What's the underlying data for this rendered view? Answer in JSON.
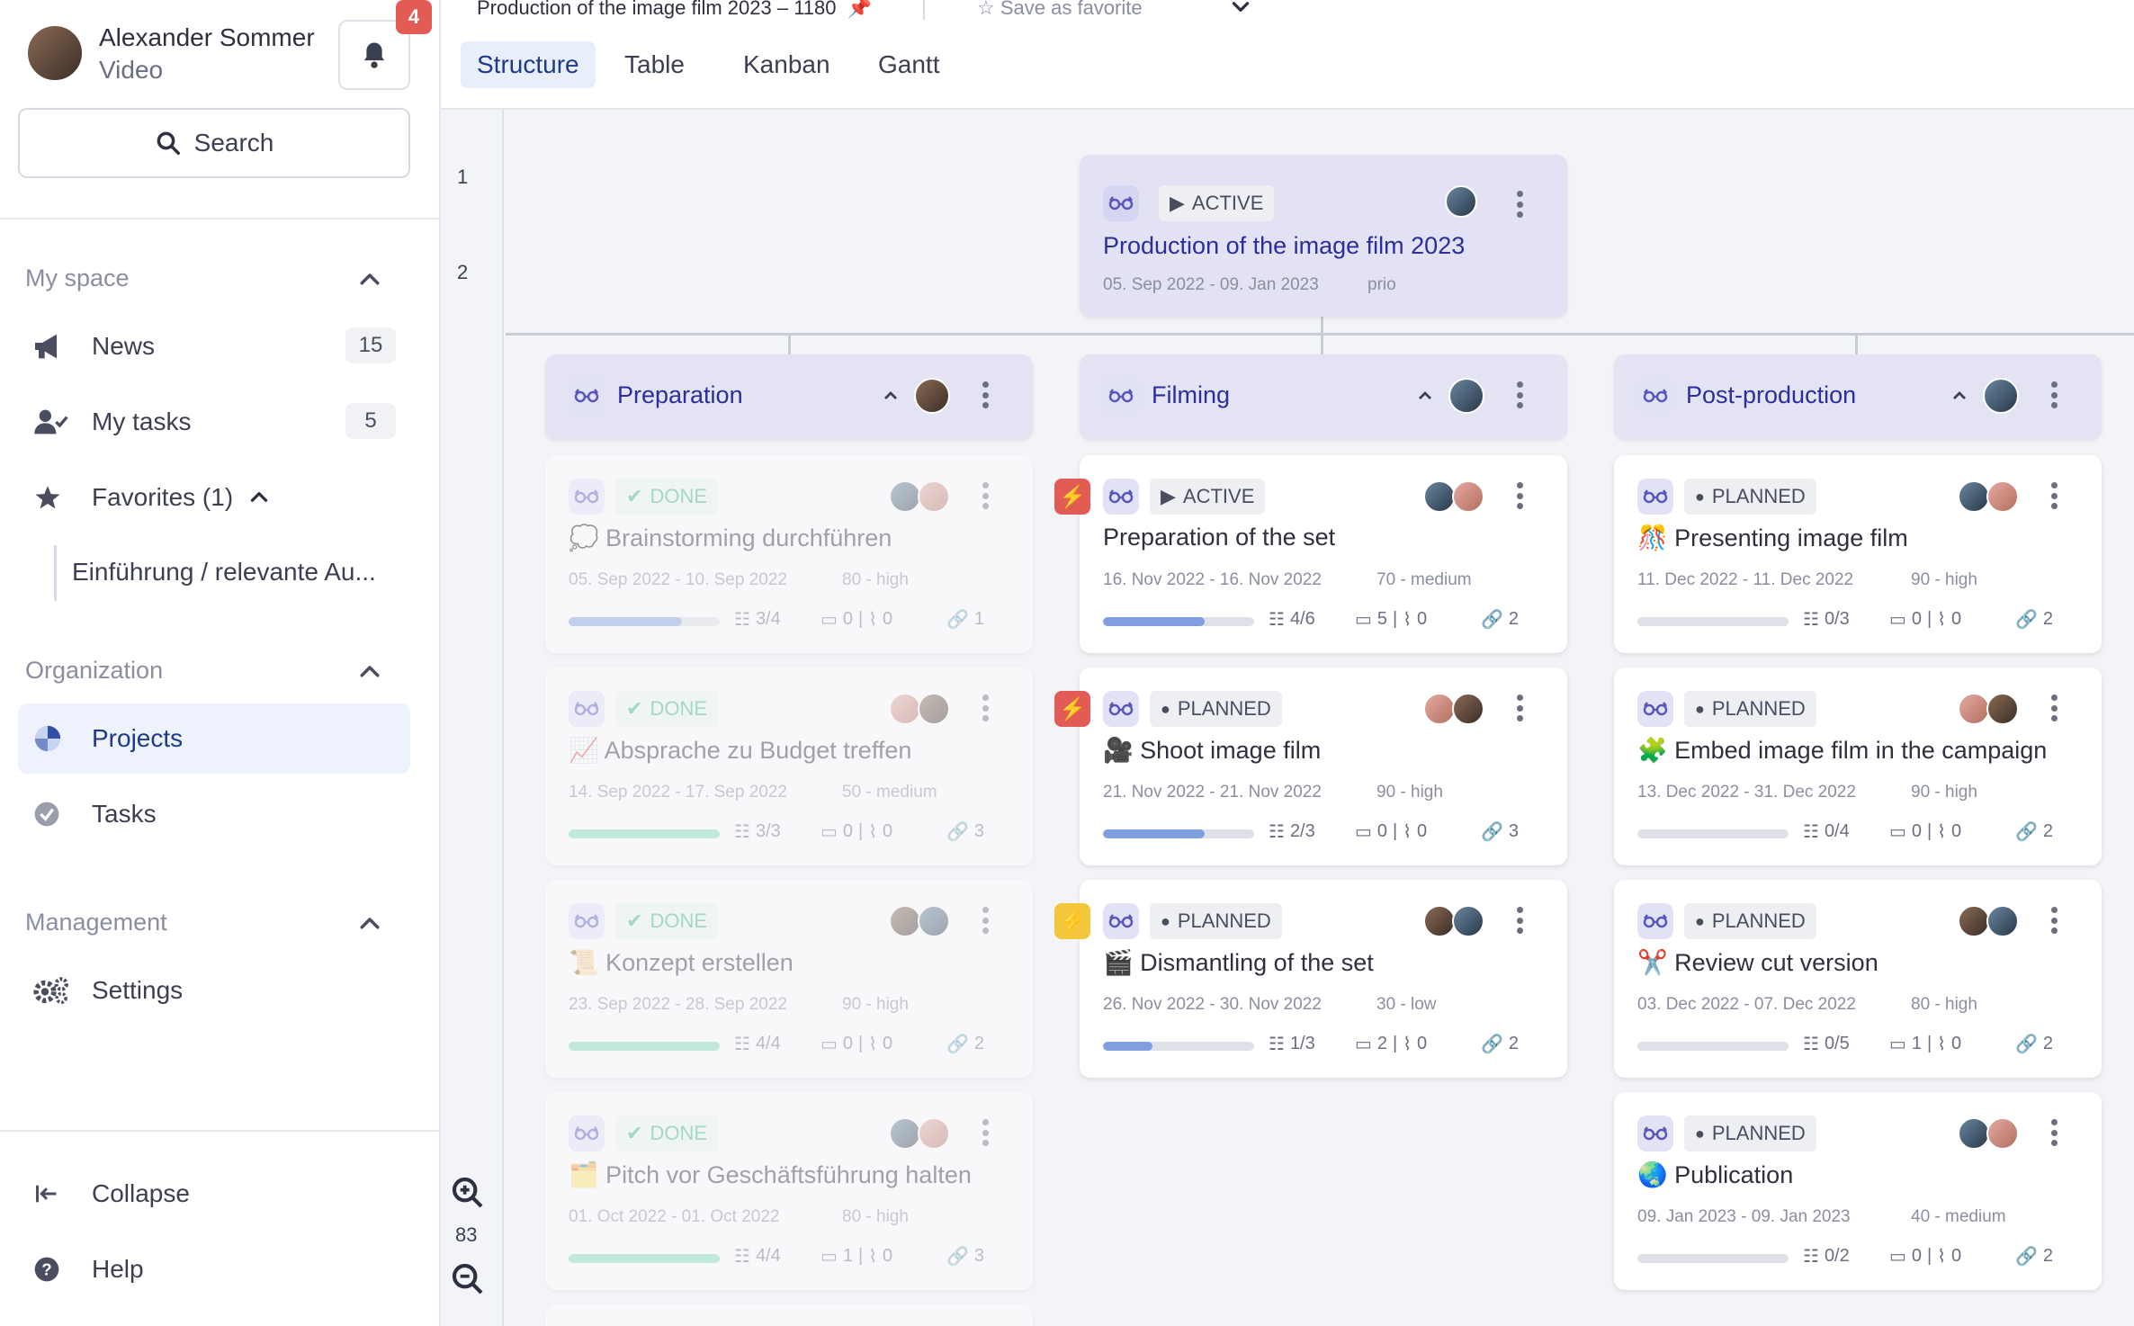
{
  "user": {
    "name": "Alexander Sommer",
    "role": "Video",
    "notifications": "4"
  },
  "search": {
    "label": "Search"
  },
  "sections": {
    "my_space": "My space",
    "organization": "Organization",
    "management": "Management"
  },
  "nav": {
    "news": {
      "label": "News",
      "count": "15"
    },
    "my_tasks": {
      "label": "My tasks",
      "count": "5"
    },
    "favorites": {
      "label": "Favorites (1)"
    },
    "favorite_item": {
      "label": "Einführung / relevante Au..."
    },
    "projects": {
      "label": "Projects"
    },
    "tasks": {
      "label": "Tasks"
    },
    "settings": {
      "label": "Settings"
    },
    "collapse": {
      "label": "Collapse"
    },
    "help": {
      "label": "Help"
    }
  },
  "header": {
    "breadcrumb": "Production of the image film 2023 – 1180",
    "save_favorite": "Save as favorite",
    "tabs": [
      "Structure",
      "Table",
      "Kanban",
      "Gantt"
    ],
    "active_tab": "Structure"
  },
  "rows": [
    "1",
    "2"
  ],
  "zoom": "83",
  "root": {
    "status": "ACTIVE",
    "title": "Production of the image film 2023",
    "dates": "05. Sep 2022 - 09. Jan 2023",
    "prio": "prio"
  },
  "columns": [
    {
      "title": "Preparation"
    },
    {
      "title": "Filming"
    },
    {
      "title": "Post-production"
    }
  ],
  "cards": {
    "prep": [
      {
        "status": "DONE",
        "title": "Brainstorming durchführen",
        "emoji": "💭",
        "dates": "05. Sep 2022 - 10. Sep 2022",
        "prio": "80 - high",
        "tasks": "3/4",
        "comments": "0",
        "attachments": "0",
        "links": "1",
        "progress": 0.75
      },
      {
        "status": "DONE",
        "title": "Absprache zu Budget treffen",
        "emoji": "📈",
        "dates": "14. Sep 2022 - 17. Sep 2022",
        "prio": "50 - medium",
        "tasks": "3/3",
        "comments": "0",
        "attachments": "0",
        "links": "3",
        "progress": 1.0
      },
      {
        "status": "DONE",
        "title": "Konzept erstellen",
        "emoji": "📜",
        "dates": "23. Sep 2022 - 28. Sep 2022",
        "prio": "90 - high",
        "tasks": "4/4",
        "comments": "0",
        "attachments": "0",
        "links": "2",
        "progress": 1.0
      },
      {
        "status": "DONE",
        "title": "Pitch vor Geschäftsführung halten",
        "emoji": "🗂️",
        "dates": "01. Oct 2022 - 01. Oct 2022",
        "prio": "80 - high",
        "tasks": "4/4",
        "comments": "1",
        "attachments": "0",
        "links": "3",
        "progress": 1.0
      }
    ],
    "film": [
      {
        "status": "ACTIVE",
        "title": "Preparation of the set",
        "emoji": "",
        "dates": "16. Nov 2022 - 16. Nov 2022",
        "prio": "70 - medium",
        "tasks": "4/6",
        "comments": "5",
        "attachments": "0",
        "links": "2",
        "progress": 0.67
      },
      {
        "status": "PLANNED",
        "title": "Shoot image film",
        "emoji": "🎥",
        "dates": "21. Nov 2022 - 21. Nov 2022",
        "prio": "90 - high",
        "tasks": "2/3",
        "comments": "0",
        "attachments": "0",
        "links": "3",
        "progress": 0.67
      },
      {
        "status": "PLANNED",
        "title": "Dismantling of the set",
        "emoji": "🎬",
        "dates": "26. Nov 2022 - 30. Nov 2022",
        "prio": "30 - low",
        "tasks": "1/3",
        "comments": "2",
        "attachments": "0",
        "links": "2",
        "progress": 0.33
      }
    ],
    "post": [
      {
        "status": "PLANNED",
        "title": "Presenting image film",
        "emoji": "🎊",
        "dates": "11. Dec 2022 - 11. Dec 2022",
        "prio": "90 - high",
        "tasks": "0/3",
        "comments": "0",
        "attachments": "0",
        "links": "2",
        "progress": 0
      },
      {
        "status": "PLANNED",
        "title": "Embed image film in the campaign",
        "emoji": "🧩",
        "dates": "13. Dec 2022 - 31. Dec 2022",
        "prio": "90 - high",
        "tasks": "0/4",
        "comments": "0",
        "attachments": "0",
        "links": "2",
        "progress": 0
      },
      {
        "status": "PLANNED",
        "title": "Review cut version",
        "emoji": "✂️",
        "dates": "03. Dec 2022 - 07. Dec 2022",
        "prio": "80 - high",
        "tasks": "0/5",
        "comments": "1",
        "attachments": "0",
        "links": "2",
        "progress": 0
      },
      {
        "status": "PLANNED",
        "title": "Publication",
        "emoji": "🌏",
        "dates": "09. Jan 2023 - 09. Jan 2023",
        "prio": "40 - medium",
        "tasks": "0/2",
        "comments": "0",
        "attachments": "0",
        "links": "2",
        "progress": 0
      }
    ]
  },
  "colors": {
    "accent": "#1e3a8a",
    "done": "#3bb277",
    "progress_blue": "#7f9fe0",
    "progress_green": "#7cdbb0",
    "flag_red": "#e25c55",
    "flag_yellow": "#f3c63b"
  }
}
